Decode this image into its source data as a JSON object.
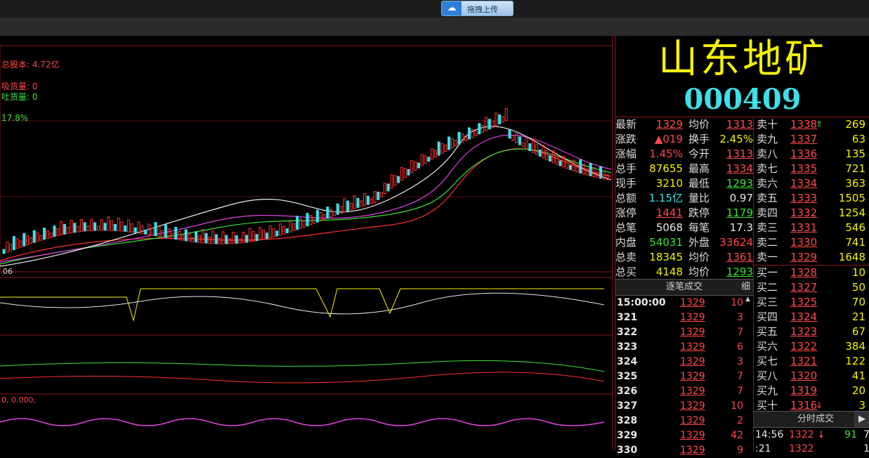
{
  "toolbar": {
    "upload_label": "拖拽上传"
  },
  "stock": {
    "name": "山东地矿",
    "code": "000409"
  },
  "chart_labels": {
    "total_shares": "总股本: 4.72亿",
    "absorb": "吸货量: 0",
    "release": "吐货量: 0",
    "percent": "17.8%",
    "date": "06",
    "sub_value": "0, 0.000,"
  },
  "quote": {
    "rows": [
      {
        "k1": "最新",
        "v1": "1329",
        "c1": "red",
        "u1": true,
        "k2": "均价",
        "v2": "1313",
        "c2": "red",
        "u2": true
      },
      {
        "k1": "涨跌",
        "v1": "▲019",
        "c1": "red",
        "u1": false,
        "k2": "换手",
        "v2": "2.45%",
        "c2": "yellow",
        "u2": false
      },
      {
        "k1": "涨幅",
        "v1": "1.45%",
        "c1": "red",
        "u1": false,
        "k2": "今开",
        "v2": "1313",
        "c2": "red",
        "u2": true
      },
      {
        "k1": "总手",
        "v1": "87655",
        "c1": "yellow",
        "u1": false,
        "k2": "最高",
        "v2": "1334",
        "c2": "red",
        "u2": true
      },
      {
        "k1": "现手",
        "v1": "3210",
        "c1": "yellow",
        "u1": false,
        "k2": "最低",
        "v2": "1293",
        "c2": "green",
        "u2": true
      },
      {
        "k1": "总额",
        "v1": "1.15亿",
        "c1": "cyan",
        "u1": false,
        "k2": "量比",
        "v2": "0.97",
        "c2": "white",
        "u2": false
      },
      {
        "k1": "涨停",
        "v1": "1441",
        "c1": "red",
        "u1": true,
        "k2": "跌停",
        "v2": "1179",
        "c2": "green",
        "u2": true
      },
      {
        "k1": "总笔",
        "v1": "5068",
        "c1": "white",
        "u1": false,
        "k2": "每笔",
        "v2": "17.3",
        "c2": "white",
        "u2": false
      },
      {
        "k1": "内盘",
        "v1": "54031",
        "c1": "green",
        "u1": false,
        "k2": "外盘",
        "v2": "33624",
        "c2": "red",
        "u2": false
      },
      {
        "k1": "总卖",
        "v1": "18345",
        "c1": "yellow",
        "u1": false,
        "k2": "均价",
        "v2": "1361",
        "c2": "red",
        "u2": true
      },
      {
        "k1": "总买",
        "v1": "4148",
        "c1": "yellow",
        "u1": false,
        "k2": "均价",
        "v2": "1293",
        "c2": "green",
        "u2": true
      }
    ]
  },
  "book": [
    {
      "label": "卖十",
      "price": "1338",
      "vol": "269",
      "arrow": "⇑",
      "acolor": "#39e639"
    },
    {
      "label": "卖九",
      "price": "1337",
      "vol": "63"
    },
    {
      "label": "卖八",
      "price": "1336",
      "vol": "135"
    },
    {
      "label": "卖七",
      "price": "1335",
      "vol": "721"
    },
    {
      "label": "卖六",
      "price": "1334",
      "vol": "363"
    },
    {
      "label": "卖五",
      "price": "1333",
      "vol": "1505"
    },
    {
      "label": "卖四",
      "price": "1332",
      "vol": "1254"
    },
    {
      "label": "卖三",
      "price": "1331",
      "vol": "546"
    },
    {
      "label": "卖二",
      "price": "1330",
      "vol": "741"
    },
    {
      "label": "卖一",
      "price": "1329",
      "vol": "1648"
    },
    {
      "label": "买一",
      "price": "1328",
      "vol": "10"
    },
    {
      "label": "买二",
      "price": "1327",
      "vol": "50"
    },
    {
      "label": "买三",
      "price": "1325",
      "vol": "70"
    },
    {
      "label": "买四",
      "price": "1324",
      "vol": "21"
    },
    {
      "label": "买五",
      "price": "1323",
      "vol": "67"
    },
    {
      "label": "买六",
      "price": "1322",
      "vol": "384"
    },
    {
      "label": "买七",
      "price": "1321",
      "vol": "122"
    },
    {
      "label": "买八",
      "price": "1320",
      "vol": "41"
    },
    {
      "label": "买九",
      "price": "1319",
      "vol": "20"
    },
    {
      "label": "买十",
      "price": "1316",
      "vol": "3",
      "arrow": "⇓",
      "acolor": "#ff4a4a"
    }
  ],
  "ticks": {
    "header": "逐笔成交",
    "detail": "细",
    "rows": [
      {
        "time": "15:00:00",
        "price": "1329",
        "vol": "10"
      },
      {
        "time": "321",
        "price": "1329",
        "vol": "3"
      },
      {
        "time": "322",
        "price": "1329",
        "vol": "7"
      },
      {
        "time": "323",
        "price": "1329",
        "vol": "6"
      },
      {
        "time": "324",
        "price": "1329",
        "vol": "3"
      },
      {
        "time": "325",
        "price": "1329",
        "vol": "7"
      },
      {
        "time": "326",
        "price": "1329",
        "vol": "7"
      },
      {
        "time": "327",
        "price": "1329",
        "vol": "10"
      },
      {
        "time": "328",
        "price": "1329",
        "vol": "2"
      },
      {
        "time": "329",
        "price": "1329",
        "vol": "42"
      },
      {
        "time": "330",
        "price": "1329",
        "vol": "9"
      }
    ]
  },
  "minute": {
    "header": "分时成交",
    "rows": [
      {
        "time": "14:56",
        "price": "1322",
        "arrow": "↓",
        "vol": "91",
        "vol2": "7"
      },
      {
        "time": ":21",
        "price": "1322",
        "arrow": "",
        "vol": "",
        "vol2": "1"
      }
    ]
  }
}
